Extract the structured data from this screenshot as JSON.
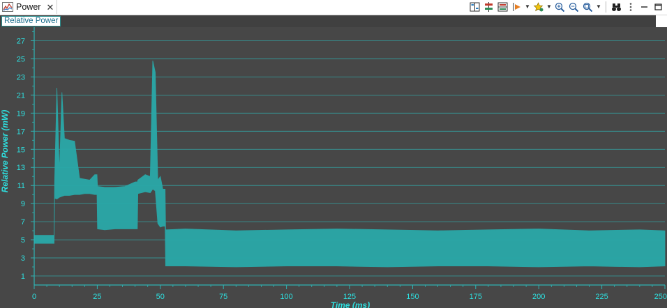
{
  "tab": {
    "title": "Power",
    "close": "✕"
  },
  "panel": {
    "label": "Relative Power"
  },
  "toolbar": {
    "icons": [
      "columns-icon",
      "split-icon",
      "rows-icon",
      "marker-icon",
      "star-icon",
      "zoom-in-icon",
      "zoom-out-icon",
      "zoom-fit-icon",
      "binoculars-icon",
      "more-icon",
      "minimize-icon",
      "maximize-icon"
    ]
  },
  "colors": {
    "plot_bg": "#474747",
    "grid": "#2fb3b3",
    "trace": "#2aa8a8",
    "axis_text": "#2ee0e0"
  },
  "chart_data": {
    "type": "line",
    "title": "",
    "xlabel": "Time  (ms)",
    "ylabel": "Relative Power  (mW)",
    "xlim": [
      0,
      250
    ],
    "ylim": [
      0,
      28.5
    ],
    "xticks": [
      0,
      25,
      50,
      75,
      100,
      125,
      150,
      175,
      200,
      225,
      250
    ],
    "yticks": [
      1,
      3,
      5,
      7,
      9,
      11,
      13,
      15,
      17,
      19,
      21,
      23,
      25,
      27
    ],
    "grid": true,
    "legend": "none",
    "series": [
      {
        "band": true,
        "x": [
          0,
          7.9,
          8.1,
          9,
          10,
          11,
          12,
          14,
          16,
          18,
          20,
          22,
          24,
          24.9,
          25.1,
          28,
          32,
          36,
          40,
          40.9,
          41.1,
          44,
          46,
          47,
          48,
          49,
          50,
          51,
          51.9,
          52.1,
          60,
          80,
          100,
          120,
          140,
          160,
          180,
          200,
          220,
          240,
          250
        ],
        "low": [
          4.6,
          4.6,
          9.6,
          9.5,
          9.7,
          9.8,
          9.9,
          9.9,
          10.0,
          10.0,
          10.1,
          10.1,
          10.0,
          10.0,
          6.2,
          6.1,
          6.2,
          6.2,
          6.2,
          6.2,
          10.1,
          10.3,
          10.2,
          10.6,
          10.4,
          6.8,
          6.4,
          6.5,
          6.5,
          2.1,
          2.1,
          2.0,
          2.1,
          2.1,
          2.0,
          2.1,
          2.1,
          2.0,
          2.1,
          2.0,
          2.1
        ],
        "high": [
          5.5,
          5.5,
          11.5,
          21.8,
          12.5,
          21.3,
          16.2,
          16.0,
          15.9,
          11.8,
          11.7,
          11.6,
          12.2,
          12.2,
          10.9,
          10.8,
          10.8,
          10.9,
          11.4,
          11.4,
          11.6,
          12.2,
          12.0,
          24.8,
          23.5,
          11.6,
          12.0,
          10.6,
          10.6,
          6.1,
          6.2,
          6.0,
          6.1,
          6.2,
          6.1,
          6.0,
          6.1,
          6.2,
          6.0,
          6.1,
          6.0
        ]
      }
    ]
  }
}
